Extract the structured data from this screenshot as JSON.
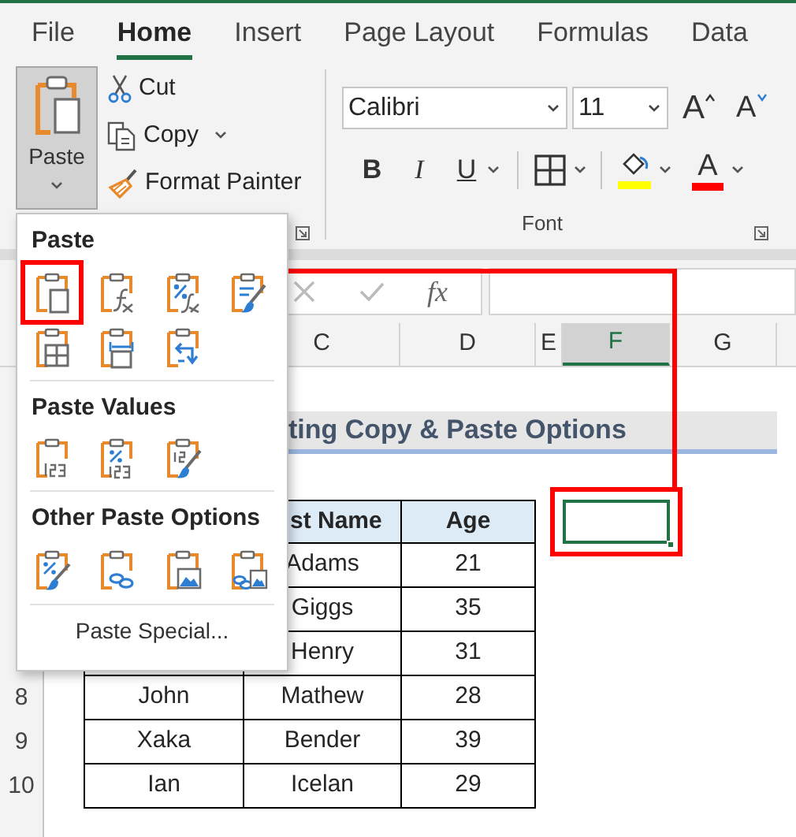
{
  "tabs": [
    {
      "label": "File",
      "selected": false
    },
    {
      "label": "Home",
      "selected": true
    },
    {
      "label": "Insert",
      "selected": false
    },
    {
      "label": "Page Layout",
      "selected": false
    },
    {
      "label": "Formulas",
      "selected": false
    },
    {
      "label": "Data",
      "selected": false
    }
  ],
  "clipboard_group": {
    "paste": "Paste",
    "cut": "Cut",
    "copy": "Copy",
    "format_painter": "Format Painter"
  },
  "font_group": {
    "font_name": "Calibri",
    "font_size": "11",
    "grow": "A",
    "shrink": "A",
    "bold": "B",
    "italic": "I",
    "underline": "U",
    "font_color": "A",
    "label": "Font"
  },
  "formula_bar": {
    "function_symbol": "fx"
  },
  "columns": [
    {
      "label": "C",
      "selected": false
    },
    {
      "label": "D",
      "selected": false
    },
    {
      "label": "E",
      "selected": false
    },
    {
      "label": "F",
      "selected": true
    },
    {
      "label": "G",
      "selected": false
    }
  ],
  "row_numbers": [
    "8",
    "9",
    "10"
  ],
  "sheet_title": "ting Copy & Paste Options",
  "table": {
    "columns": [
      "st Name",
      "Age"
    ],
    "rows": [
      {
        "last_name": "Adams",
        "age": "21"
      },
      {
        "last_name": "Giggs",
        "age": "35"
      },
      {
        "last_name": "Henry",
        "age": "31"
      },
      {
        "first_name": "John",
        "last_name": "Mathew",
        "age": "28"
      },
      {
        "first_name": "Xaka",
        "last_name": "Bender",
        "age": "39"
      },
      {
        "first_name": "Ian",
        "last_name": "Icelan",
        "age": "29"
      }
    ]
  },
  "selected_cell": {
    "highlighted": true
  },
  "paste_menu": {
    "sections": [
      {
        "title": "Paste",
        "options": [
          {
            "kind": "keep",
            "highlighted": true
          },
          {
            "kind": "formulas",
            "highlighted": false
          },
          {
            "kind": "formulas_number",
            "highlighted": false
          },
          {
            "kind": "keep_source",
            "highlighted": false
          },
          {
            "kind": "no_borders",
            "highlighted": false
          },
          {
            "kind": "column_widths",
            "highlighted": false
          },
          {
            "kind": "transpose",
            "highlighted": false
          }
        ]
      },
      {
        "title": "Paste Values",
        "options": [
          {
            "kind": "values",
            "highlighted": false
          },
          {
            "kind": "values_number",
            "highlighted": false
          },
          {
            "kind": "values_source",
            "highlighted": false
          }
        ]
      },
      {
        "title": "Other Paste Options",
        "options": [
          {
            "kind": "formatting",
            "highlighted": false
          },
          {
            "kind": "link",
            "highlighted": false
          },
          {
            "kind": "picture",
            "highlighted": false
          },
          {
            "kind": "linked_picture",
            "highlighted": false
          }
        ]
      }
    ],
    "paste_special": "Paste Special..."
  }
}
